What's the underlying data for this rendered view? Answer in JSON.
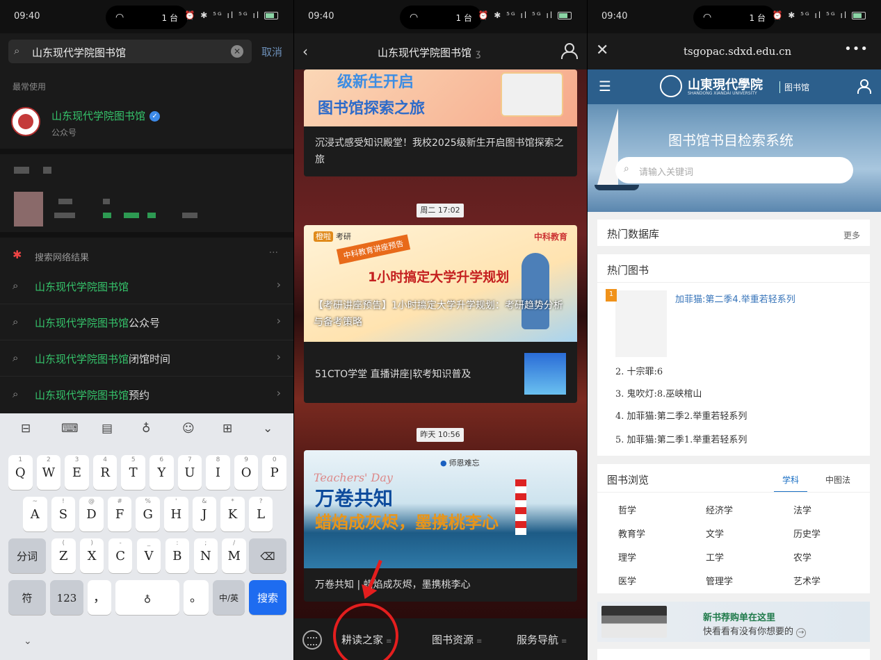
{
  "status": {
    "time": "09:40",
    "hotspot_count": "1 台",
    "signal": "⏰ ✱ ⁵ᴳ ıl ⁵ᴳ ıl"
  },
  "search": {
    "query": "山东现代学院图书馆",
    "cancel": "取消",
    "recent_label": "最常使用",
    "account_name": "山东现代学院图书馆",
    "account_type": "公众号",
    "web_label": "搜索网络结果",
    "suggestions": [
      {
        "hl": "山东现代学院图书馆",
        "rest": ""
      },
      {
        "hl": "山东现代学院图书馆",
        "rest": "公众号"
      },
      {
        "hl": "山东现代学院图书馆",
        "rest": "闭馆时间"
      },
      {
        "hl": "山东现代学院图书馆",
        "rest": "预约"
      }
    ]
  },
  "keyboard": {
    "row1": [
      {
        "k": "Q",
        "s": "1"
      },
      {
        "k": "W",
        "s": "2"
      },
      {
        "k": "E",
        "s": "3"
      },
      {
        "k": "R",
        "s": "4"
      },
      {
        "k": "T",
        "s": "5"
      },
      {
        "k": "Y",
        "s": "6"
      },
      {
        "k": "U",
        "s": "7"
      },
      {
        "k": "I",
        "s": "8"
      },
      {
        "k": "O",
        "s": "9"
      },
      {
        "k": "P",
        "s": "0"
      }
    ],
    "row2": [
      {
        "k": "A",
        "s": "~"
      },
      {
        "k": "S",
        "s": "!"
      },
      {
        "k": "D",
        "s": "@"
      },
      {
        "k": "F",
        "s": "#"
      },
      {
        "k": "G",
        "s": "%"
      },
      {
        "k": "H",
        "s": "'"
      },
      {
        "k": "J",
        "s": "&"
      },
      {
        "k": "K",
        "s": "*"
      },
      {
        "k": "L",
        "s": "?"
      }
    ],
    "row3": [
      {
        "k": "Z",
        "s": "("
      },
      {
        "k": "X",
        "s": ")"
      },
      {
        "k": "C",
        "s": "-"
      },
      {
        "k": "V",
        "s": "_"
      },
      {
        "k": "B",
        "s": ":"
      },
      {
        "k": "N",
        "s": ";"
      },
      {
        "k": "M",
        "s": "/"
      }
    ],
    "fenci": "分词",
    "fu": "符",
    "num": "123",
    "comma": "，",
    "period": "。",
    "lang": "中/英",
    "search": "搜索"
  },
  "feed": {
    "title": "山东现代学院图书馆",
    "card1_img_line1": "级新生开启",
    "card1_img_line2": "图书馆探索之旅",
    "card1_caption": "沉浸式感受知识殿堂！我校2025级新生开启图书馆探索之旅",
    "stamp1": "周二 17:02",
    "card2_tag": "橙啦",
    "card2_tag2": "考研",
    "card2_brand": "中科教育",
    "card2_banner": "中科教育讲座预告",
    "card2_big": "1小时搞定大学升学规划",
    "card2_overlay": "【考研讲座预告】1小时搞定大学升学规划：考研趋势分析与备考策略",
    "card2_sub": "51CTO学堂 直播讲座|软考知识普及",
    "stamp2": "昨天 10:56",
    "card3_tag": "师恩难忘",
    "card3_td": "Teachers' Day",
    "card3_w1": "万卷共知",
    "card3_w2": "蜡焰成灰烬，墨携桃李心",
    "card3_caption": "万卷共知 | 蜡焰成灰烬，墨携桃李心",
    "menu": [
      "耕读之家",
      "图书资源",
      "服务导航"
    ]
  },
  "opac": {
    "url": "tsgopac.sdxd.edu.cn",
    "uni_name": "山東現代學院",
    "uni_en": "SHANDONG XIANDAI UNIVERSITY",
    "lib": "图书馆",
    "system_title": "图书馆书目检索系统",
    "search_placeholder": "请输入关键词",
    "hot_db": "热门数据库",
    "more": "更多",
    "hot_books": "热门图书",
    "top_book": "加菲猫:第二季4.举重若轻系列",
    "books": [
      "2. 十宗罪:6",
      "3. 鬼吹灯:8.巫峡棺山",
      "4. 加菲猫:第二季2.举重若轻系列",
      "5. 加菲猫:第二季1.举重若轻系列"
    ],
    "browse": "图书浏览",
    "tab_subject": "学科",
    "tab_clc": "中图法",
    "subjects": [
      "哲学",
      "经济学",
      "法学",
      "教育学",
      "文学",
      "历史学",
      "理学",
      "工学",
      "农学",
      "医学",
      "管理学",
      "艺术学"
    ],
    "ad_line1": "新书荐购单在这里",
    "ad_line2": "快看看有没有你想要的"
  }
}
